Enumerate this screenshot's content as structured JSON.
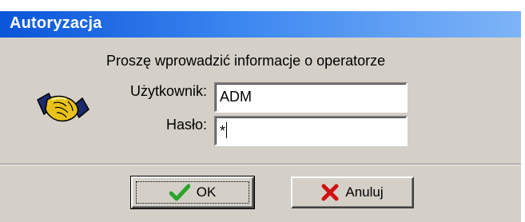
{
  "window": {
    "title": "Autoryzacja"
  },
  "form": {
    "instruction": "Proszę wprowadzić informacje o operatorze",
    "user_label": "Użytkownik:",
    "user_value": "ADM",
    "password_label": "Hasło:",
    "password_value": "*"
  },
  "buttons": {
    "ok_label": "OK",
    "cancel_label": "Anuluj"
  },
  "icons": {
    "handshake": "handshake-icon",
    "ok": "checkmark-icon",
    "cancel": "red-x-icon"
  },
  "colors": {
    "title_gradient_start": "#0a55d8",
    "title_gradient_end": "#7fb5f7",
    "dialog_bg": "#d4d0c8",
    "checkmark": "#2aa52a",
    "cancel_x": "#d01010"
  }
}
